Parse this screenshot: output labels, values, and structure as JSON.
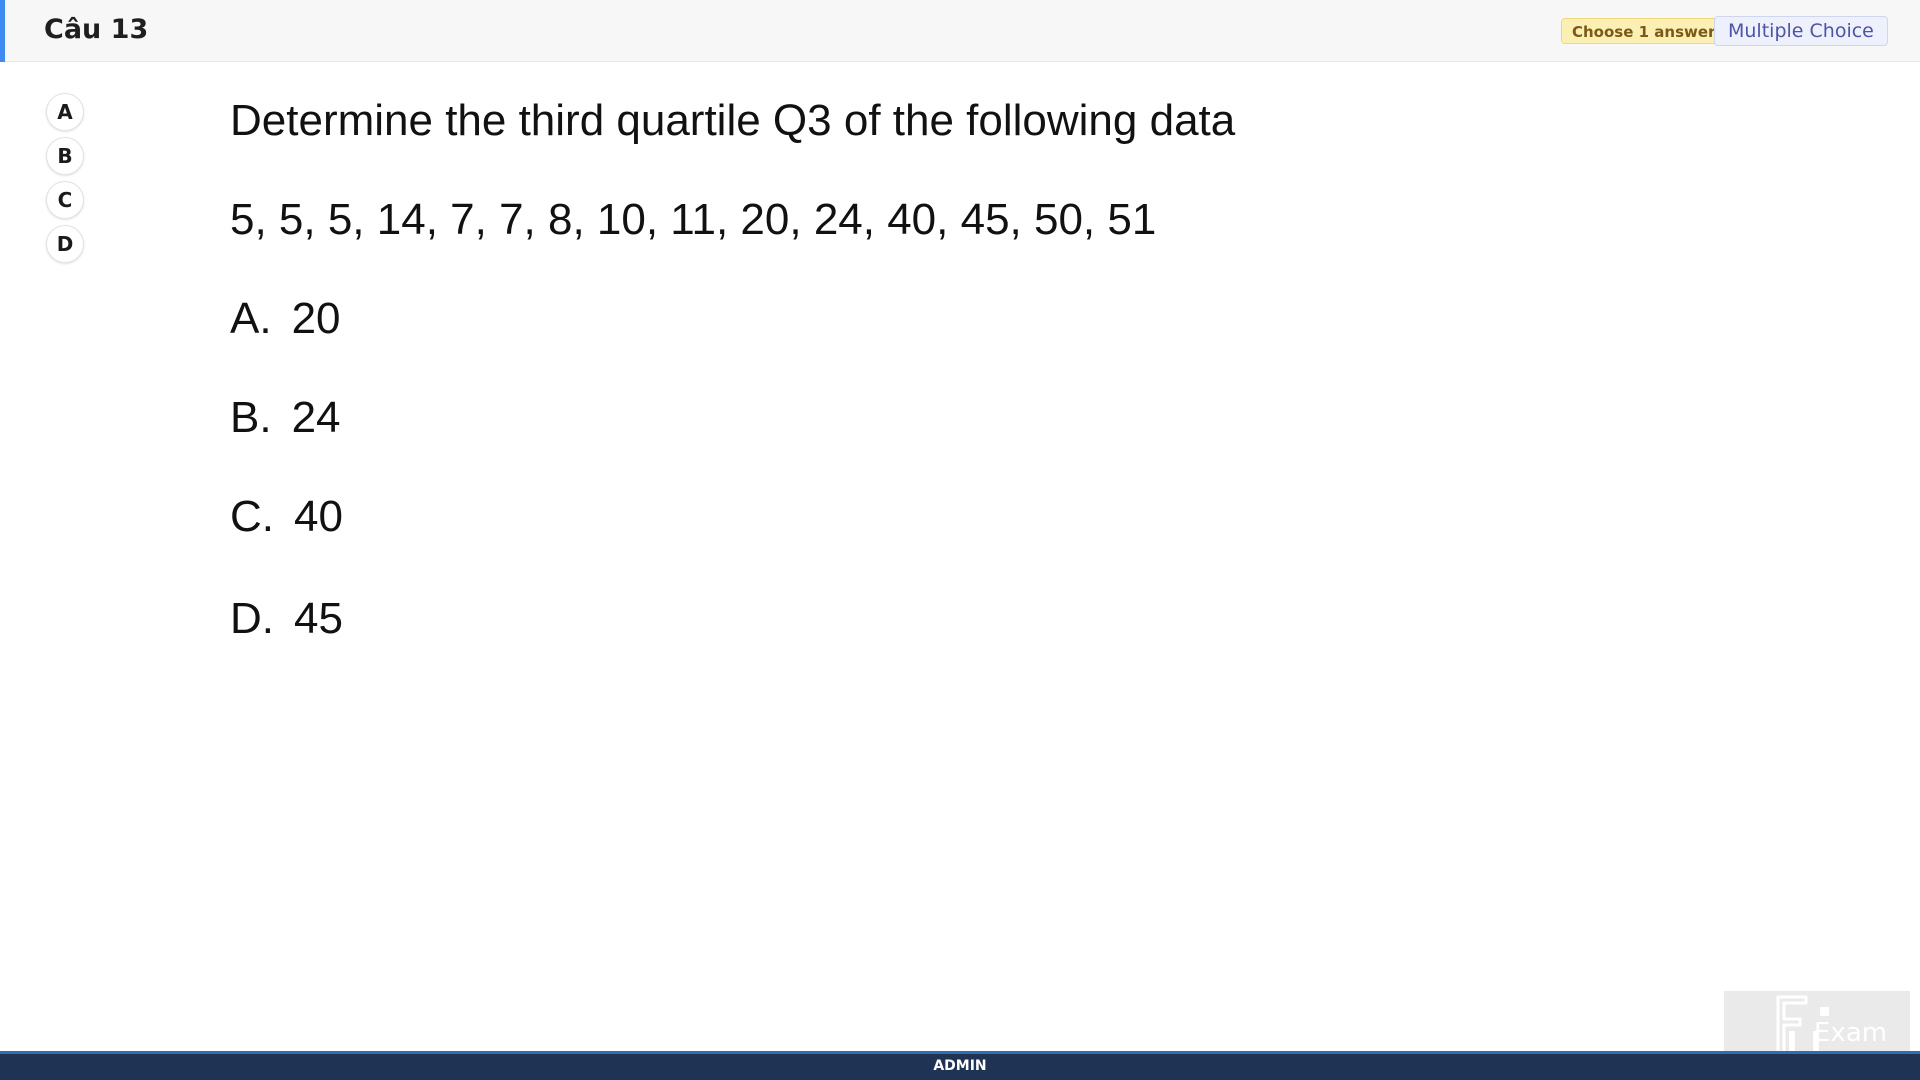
{
  "header": {
    "title": "Câu 13",
    "badge_choose": "Choose 1 answer",
    "badge_type": "Multiple Choice",
    "accent_color": "#3d8bf0"
  },
  "answer_options": [
    "A",
    "B",
    "C",
    "D"
  ],
  "question": {
    "prompt": "Determine the third quartile Q3 of the following data",
    "data": "5, 5, 5, 14, 7, 7, 8, 10, 11, 20, 24, 40, 45, 50, 51",
    "choices": [
      {
        "letter": "A.",
        "value": "20"
      },
      {
        "letter": "B.",
        "value": "24"
      },
      {
        "letter": "C.",
        "value": "40"
      },
      {
        "letter": "D.",
        "value": "45"
      }
    ]
  },
  "footer": {
    "label": "ADMIN"
  },
  "logo": {
    "icon": "fu-exam-logo",
    "text": "Exam"
  }
}
